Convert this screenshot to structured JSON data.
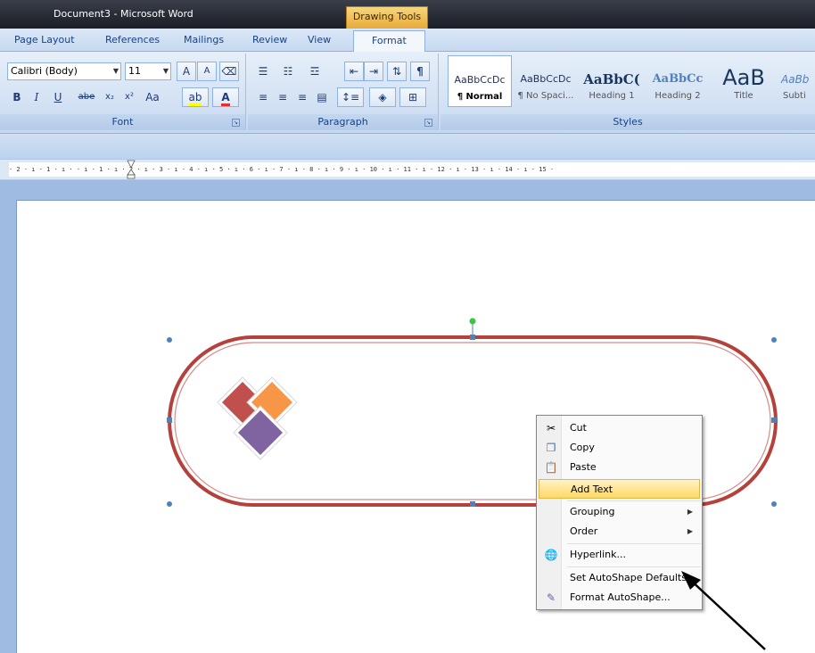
{
  "window": {
    "title": "Document3 - Microsoft Word",
    "contextual_tab": "Drawing Tools"
  },
  "tabs": [
    {
      "label": "Page Layout"
    },
    {
      "label": "References"
    },
    {
      "label": "Mailings"
    },
    {
      "label": "Review"
    },
    {
      "label": "View"
    },
    {
      "label": "Format",
      "active": true
    }
  ],
  "ribbon": {
    "font": {
      "font_name": "Calibri (Body)",
      "font_size": "11",
      "label": "Font",
      "bold": "B",
      "italic": "I",
      "underline": "U",
      "strike": "abe",
      "subscript": "x₂",
      "superscript": "x²",
      "change_case": "Aa",
      "grow": "A",
      "shrink": "A"
    },
    "paragraph": {
      "label": "Paragraph",
      "pilcrow": "¶"
    },
    "styles": {
      "label": "Styles",
      "items": [
        {
          "sample": "AaBbCcDc",
          "name": "¶ Normal",
          "selected": true
        },
        {
          "sample": "AaBbCcDc",
          "name": "¶ No Spaci..."
        },
        {
          "sample": "AaBbC(",
          "name": "Heading 1"
        },
        {
          "sample": "AaBbCc",
          "name": "Heading 2"
        },
        {
          "sample": "AaB",
          "name": "Title"
        },
        {
          "sample": "AaBb",
          "name": "Subti"
        }
      ]
    }
  },
  "ruler": {
    "text": "· 2 · ı · 1 · ı ·   · ı · 1 · ı · 2 · ı · 3 · ı · 4 · ı · 5 · ı · 6 · ı · 7 · ı · 8 · ı · 9 · ı · 10 · ı · 11 · ı · 12 · ı · 13 · ı · 14 · ı · 15 ·"
  },
  "context_menu": {
    "items": [
      {
        "label": "Cut",
        "icon": "scissors-icon"
      },
      {
        "label": "Copy",
        "icon": "copy-icon"
      },
      {
        "label": "Paste",
        "icon": "paste-icon"
      },
      {
        "label": "Add Text",
        "highlighted": true
      },
      {
        "label": "Grouping",
        "submenu": true
      },
      {
        "label": "Order",
        "submenu": true
      },
      {
        "label": "Hyperlink...",
        "icon": "hyperlink-icon"
      },
      {
        "label": "Set AutoShape Defaults"
      },
      {
        "label": "Format AutoShape...",
        "icon": "format-shape-icon"
      }
    ]
  },
  "colors": {
    "shape_outline": "#b5413c",
    "diamond_red": "#c0504d",
    "diamond_orange": "#f79646",
    "diamond_purple": "#8064a2",
    "handle_blue": "#4f81bd",
    "rotate_handle_green": "#3ec43e",
    "menu_highlight": "#ffd865"
  }
}
